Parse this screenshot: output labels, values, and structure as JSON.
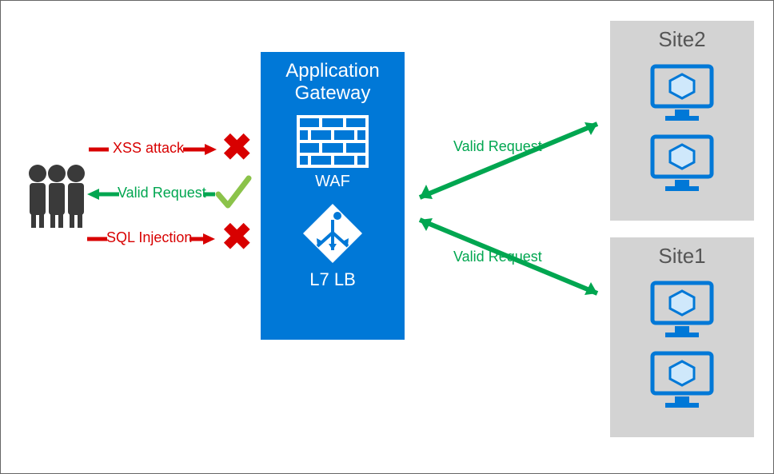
{
  "gateway": {
    "title_line1": "Application",
    "title_line2": "Gateway",
    "waf_label": "WAF",
    "l7_label": "L7 LB"
  },
  "requests_in": {
    "xss": {
      "label": "XSS attack",
      "blocked": true
    },
    "valid": {
      "label": "Valid Request",
      "blocked": false
    },
    "sqli": {
      "label": "SQL Injection",
      "blocked": true
    }
  },
  "requests_out": {
    "to_site2": {
      "label": "Valid Request"
    },
    "to_site1": {
      "label": "Valid Request"
    }
  },
  "sites": {
    "site2": {
      "title": "Site2",
      "vm_count": 2
    },
    "site1": {
      "title": "Site1",
      "vm_count": 2
    }
  },
  "colors": {
    "azure_blue": "#0078d7",
    "block_red": "#d80000",
    "allow_green": "#00a650",
    "site_bg": "#d3d3d3"
  }
}
